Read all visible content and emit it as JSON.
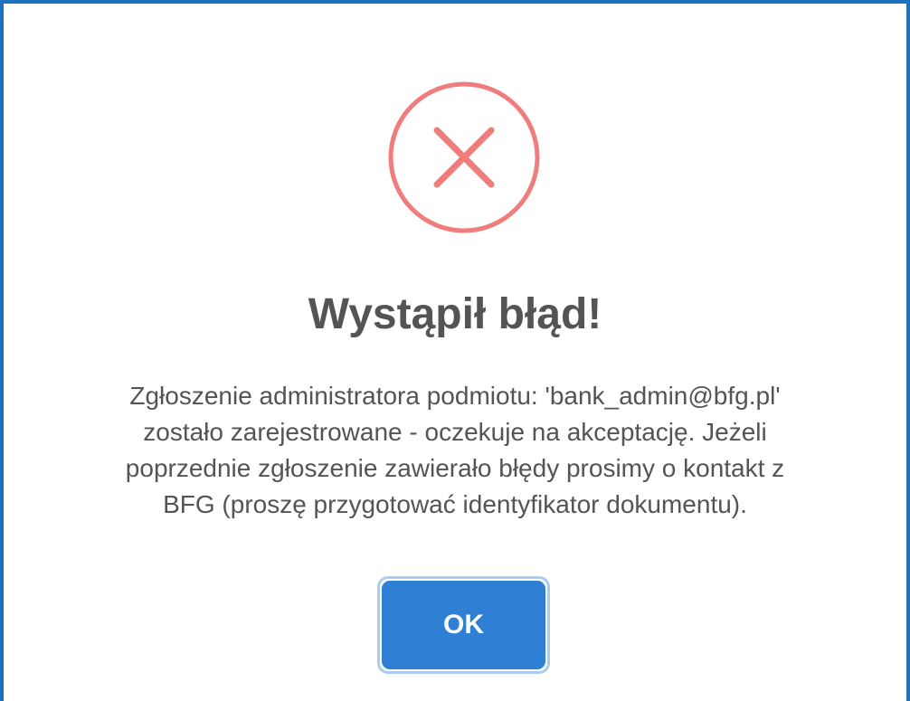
{
  "dialog": {
    "title": "Wystąpił błąd!",
    "message_lines": [
      "Zgłoszenie administratora podmiotu: 'bank_admin@bfg.pl'",
      "zostało zarejestrowane - oczekuje na akceptację. Jeżeli",
      "poprzednie zgłoszenie zawierało błędy prosimy o kontakt z",
      "BFG (proszę przygotować identyfikator dokumentu)."
    ],
    "ok_label": "OK",
    "icon": "error-x-icon"
  },
  "colors": {
    "frame_border": "#1b73c0",
    "error_icon": "#f07c7c",
    "title_text": "#545454",
    "button_bg": "#2f80d4",
    "button_outline": "#a9cdec"
  }
}
